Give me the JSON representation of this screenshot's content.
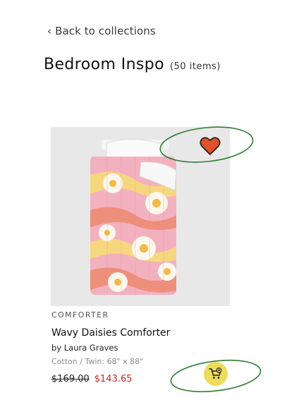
{
  "nav": {
    "back_label": "Back to collections"
  },
  "collection": {
    "title": "Bedroom Inspo",
    "count": "(50 items)"
  },
  "product": {
    "category": "COMFORTER",
    "name": "Wavy Daisies Comforter",
    "artist": "by Laura Graves",
    "variant": "Cotton / Twin: 68\" x 88\"",
    "original_price": "$169.00",
    "sale_price": "$143.65",
    "image_icon": "comforter-product-image",
    "favorite_icon": "heart-icon",
    "cart_icon": "add-to-cart-icon"
  },
  "colors": {
    "heart": "#e0522c",
    "cart_bg": "#ecdc5c",
    "sale": "#c62828",
    "annotation": "#2e7d32"
  }
}
